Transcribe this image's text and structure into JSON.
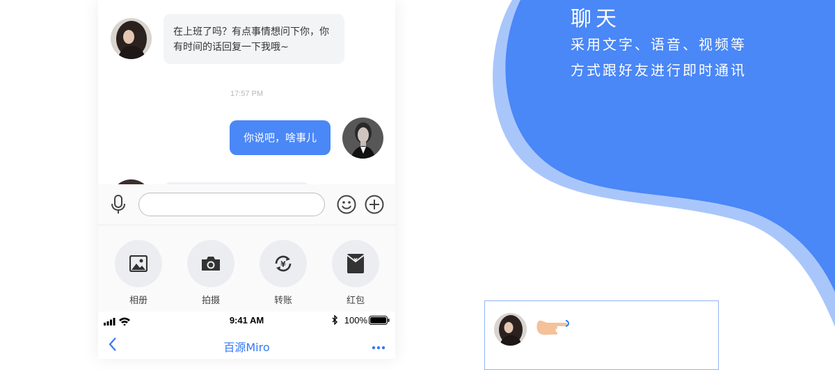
{
  "feature": {
    "title": "聊天",
    "desc_line1": "采用文字、语音、视频等",
    "desc_line2": "方式跟好友进行即时通讯"
  },
  "chat": {
    "incoming_text": "在上班了吗？有点事情想问下你，你有时间的话回复一下我哦~",
    "timestamp": "17:57 PM",
    "outgoing_text": "你说吧，啥事儿"
  },
  "input": {
    "value": "",
    "placeholder": ""
  },
  "actions": [
    {
      "label": "相册",
      "icon": "photo-icon"
    },
    {
      "label": "拍摄",
      "icon": "camera-icon"
    },
    {
      "label": "转账",
      "icon": "transfer-icon"
    },
    {
      "label": "红包",
      "icon": "red-packet-icon"
    }
  ],
  "status_bar": {
    "time": "9:41 AM",
    "battery": "100%"
  },
  "nav": {
    "title": "百源Miro"
  },
  "colors": {
    "accent": "#4a87f7",
    "blob_main": "#4a87f7",
    "blob_shadow": "#a9c6fb",
    "nav_text": "#3478f6"
  }
}
